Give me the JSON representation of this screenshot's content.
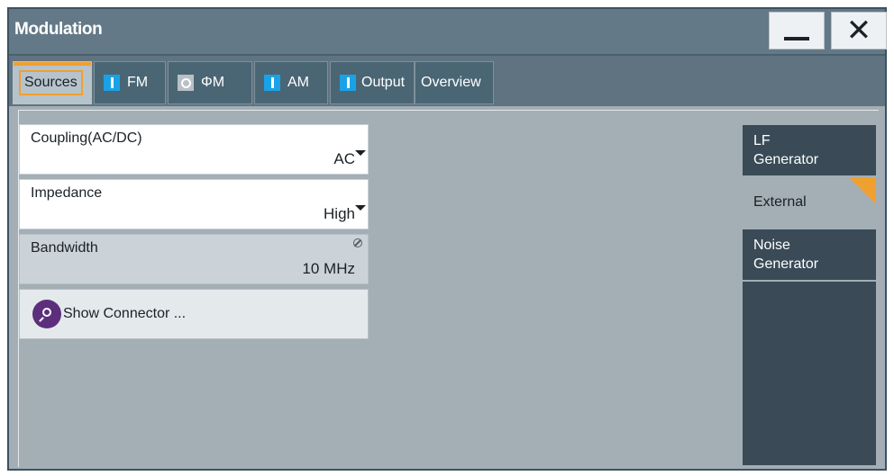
{
  "window": {
    "title": "Modulation",
    "minimize_glyph": "—",
    "close_glyph": "✕"
  },
  "tabs": [
    {
      "label": "Sources",
      "state": "selected"
    },
    {
      "label": "FM",
      "state": "on"
    },
    {
      "label": "ΦM",
      "state": "off",
      "indicator_text": "O"
    },
    {
      "label": "AM",
      "state": "on"
    },
    {
      "label": "Output",
      "state": "on"
    },
    {
      "label": "Overview",
      "state": "none"
    }
  ],
  "fields": {
    "coupling": {
      "label": "Coupling(AC/DC)",
      "value": "AC"
    },
    "impedance": {
      "label": "Impedance",
      "value": "High"
    },
    "bandwidth": {
      "label": "Bandwidth",
      "value": "10 MHz"
    }
  },
  "show_connector": {
    "label": "Show Connector ...",
    "icon": "search-icon"
  },
  "side_menu": [
    {
      "label": "LF\nGenerator",
      "selected": false
    },
    {
      "label": "External",
      "selected": true
    },
    {
      "label": "Noise\nGenerator",
      "selected": false
    }
  ],
  "colors": {
    "accent": "#f0a030",
    "indicator_on": "#1aa2e6",
    "indicator_off": "#b9c1c6",
    "titlebar": "#647987",
    "icon_purple": "#5c2e7b"
  }
}
